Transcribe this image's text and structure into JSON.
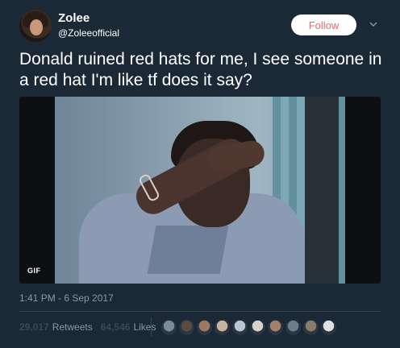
{
  "author": {
    "display_name": "Zolee",
    "handle": "@Zoleeofficial",
    "follow_label": "Follow"
  },
  "tweet": {
    "text": "Donald ruined red hats for me, I see someone in a red hat I'm like tf does it say?",
    "media_badge": "GIF",
    "timestamp": "1:41 PM - 6 Sep 2017"
  },
  "stats": {
    "retweets_count": "29,017",
    "retweets_label": "Retweets",
    "likes_count": "64,546",
    "likes_label": "Likes"
  },
  "likers": [
    {
      "color": "#7b8a9a"
    },
    {
      "color": "#5a4a3f"
    },
    {
      "color": "#9a7a62"
    },
    {
      "color": "#c7b2a0"
    },
    {
      "color": "#b9c4d0"
    },
    {
      "color": "#d9d2ca"
    },
    {
      "color": "#a37f6d"
    },
    {
      "color": "#6d7c8c"
    },
    {
      "color": "#8b7a6a"
    },
    {
      "color": "#e0e0e0"
    }
  ],
  "colors": {
    "background": "#1b2836",
    "secondary_text": "#8899a6",
    "follow_text": "#e46a6a"
  }
}
